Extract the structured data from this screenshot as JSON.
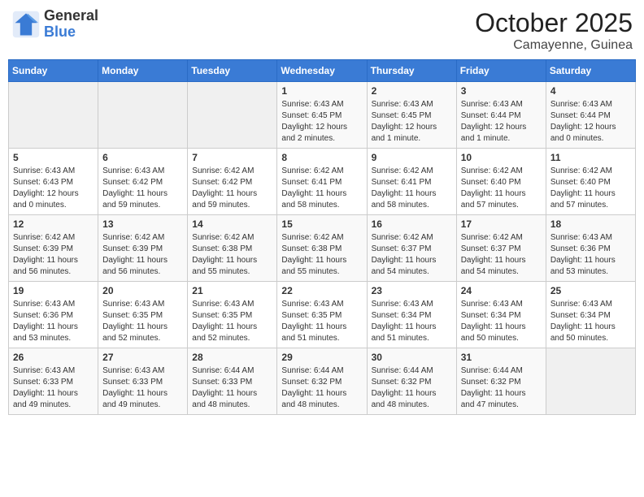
{
  "header": {
    "logo_general": "General",
    "logo_blue": "Blue",
    "month": "October 2025",
    "location": "Camayenne, Guinea"
  },
  "days_of_week": [
    "Sunday",
    "Monday",
    "Tuesday",
    "Wednesday",
    "Thursday",
    "Friday",
    "Saturday"
  ],
  "weeks": [
    [
      {
        "num": "",
        "info": ""
      },
      {
        "num": "",
        "info": ""
      },
      {
        "num": "",
        "info": ""
      },
      {
        "num": "1",
        "info": "Sunrise: 6:43 AM\nSunset: 6:45 PM\nDaylight: 12 hours and 2 minutes."
      },
      {
        "num": "2",
        "info": "Sunrise: 6:43 AM\nSunset: 6:45 PM\nDaylight: 12 hours and 1 minute."
      },
      {
        "num": "3",
        "info": "Sunrise: 6:43 AM\nSunset: 6:44 PM\nDaylight: 12 hours and 1 minute."
      },
      {
        "num": "4",
        "info": "Sunrise: 6:43 AM\nSunset: 6:44 PM\nDaylight: 12 hours and 0 minutes."
      }
    ],
    [
      {
        "num": "5",
        "info": "Sunrise: 6:43 AM\nSunset: 6:43 PM\nDaylight: 12 hours and 0 minutes."
      },
      {
        "num": "6",
        "info": "Sunrise: 6:43 AM\nSunset: 6:42 PM\nDaylight: 11 hours and 59 minutes."
      },
      {
        "num": "7",
        "info": "Sunrise: 6:42 AM\nSunset: 6:42 PM\nDaylight: 11 hours and 59 minutes."
      },
      {
        "num": "8",
        "info": "Sunrise: 6:42 AM\nSunset: 6:41 PM\nDaylight: 11 hours and 58 minutes."
      },
      {
        "num": "9",
        "info": "Sunrise: 6:42 AM\nSunset: 6:41 PM\nDaylight: 11 hours and 58 minutes."
      },
      {
        "num": "10",
        "info": "Sunrise: 6:42 AM\nSunset: 6:40 PM\nDaylight: 11 hours and 57 minutes."
      },
      {
        "num": "11",
        "info": "Sunrise: 6:42 AM\nSunset: 6:40 PM\nDaylight: 11 hours and 57 minutes."
      }
    ],
    [
      {
        "num": "12",
        "info": "Sunrise: 6:42 AM\nSunset: 6:39 PM\nDaylight: 11 hours and 56 minutes."
      },
      {
        "num": "13",
        "info": "Sunrise: 6:42 AM\nSunset: 6:39 PM\nDaylight: 11 hours and 56 minutes."
      },
      {
        "num": "14",
        "info": "Sunrise: 6:42 AM\nSunset: 6:38 PM\nDaylight: 11 hours and 55 minutes."
      },
      {
        "num": "15",
        "info": "Sunrise: 6:42 AM\nSunset: 6:38 PM\nDaylight: 11 hours and 55 minutes."
      },
      {
        "num": "16",
        "info": "Sunrise: 6:42 AM\nSunset: 6:37 PM\nDaylight: 11 hours and 54 minutes."
      },
      {
        "num": "17",
        "info": "Sunrise: 6:42 AM\nSunset: 6:37 PM\nDaylight: 11 hours and 54 minutes."
      },
      {
        "num": "18",
        "info": "Sunrise: 6:43 AM\nSunset: 6:36 PM\nDaylight: 11 hours and 53 minutes."
      }
    ],
    [
      {
        "num": "19",
        "info": "Sunrise: 6:43 AM\nSunset: 6:36 PM\nDaylight: 11 hours and 53 minutes."
      },
      {
        "num": "20",
        "info": "Sunrise: 6:43 AM\nSunset: 6:35 PM\nDaylight: 11 hours and 52 minutes."
      },
      {
        "num": "21",
        "info": "Sunrise: 6:43 AM\nSunset: 6:35 PM\nDaylight: 11 hours and 52 minutes."
      },
      {
        "num": "22",
        "info": "Sunrise: 6:43 AM\nSunset: 6:35 PM\nDaylight: 11 hours and 51 minutes."
      },
      {
        "num": "23",
        "info": "Sunrise: 6:43 AM\nSunset: 6:34 PM\nDaylight: 11 hours and 51 minutes."
      },
      {
        "num": "24",
        "info": "Sunrise: 6:43 AM\nSunset: 6:34 PM\nDaylight: 11 hours and 50 minutes."
      },
      {
        "num": "25",
        "info": "Sunrise: 6:43 AM\nSunset: 6:34 PM\nDaylight: 11 hours and 50 minutes."
      }
    ],
    [
      {
        "num": "26",
        "info": "Sunrise: 6:43 AM\nSunset: 6:33 PM\nDaylight: 11 hours and 49 minutes."
      },
      {
        "num": "27",
        "info": "Sunrise: 6:43 AM\nSunset: 6:33 PM\nDaylight: 11 hours and 49 minutes."
      },
      {
        "num": "28",
        "info": "Sunrise: 6:44 AM\nSunset: 6:33 PM\nDaylight: 11 hours and 48 minutes."
      },
      {
        "num": "29",
        "info": "Sunrise: 6:44 AM\nSunset: 6:32 PM\nDaylight: 11 hours and 48 minutes."
      },
      {
        "num": "30",
        "info": "Sunrise: 6:44 AM\nSunset: 6:32 PM\nDaylight: 11 hours and 48 minutes."
      },
      {
        "num": "31",
        "info": "Sunrise: 6:44 AM\nSunset: 6:32 PM\nDaylight: 11 hours and 47 minutes."
      },
      {
        "num": "",
        "info": ""
      }
    ]
  ]
}
